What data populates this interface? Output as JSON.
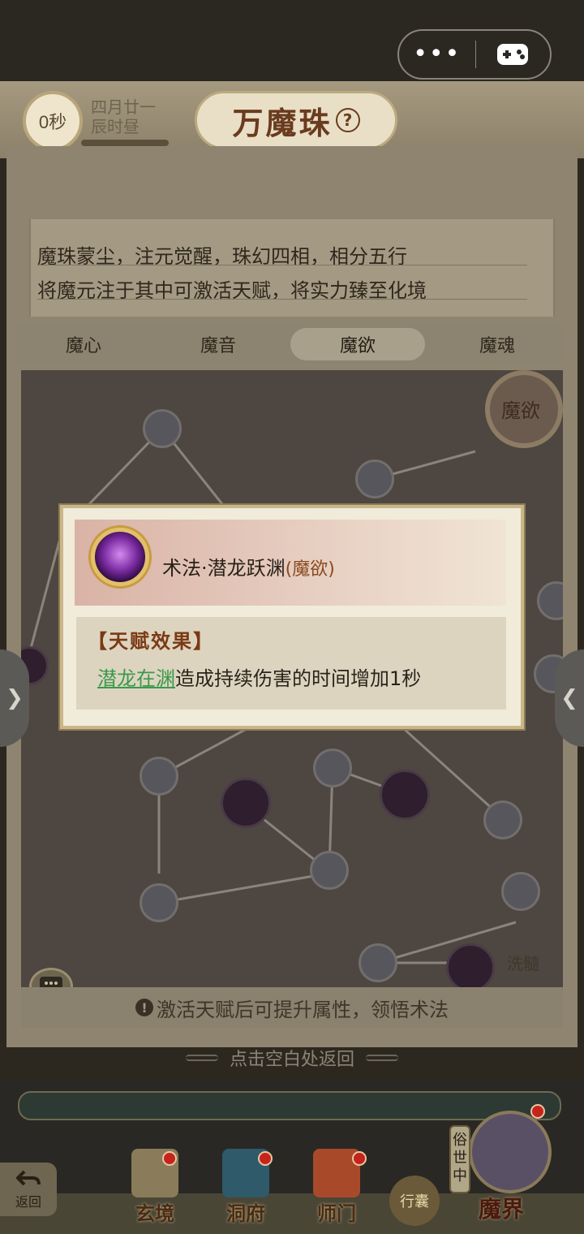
{
  "header": {
    "timer": "0秒",
    "date_line1": "四月廿一",
    "date_line2": "辰时昼",
    "title": "万魔珠",
    "help_label": "?"
  },
  "description": {
    "line1": "魔珠蒙尘，注元觉醒，珠幻四相，相分五行",
    "line2": "将魔元注于其中可激活天赋，将实力臻至化境"
  },
  "tabs": [
    {
      "label": "魔心",
      "active": false
    },
    {
      "label": "魔音",
      "active": false
    },
    {
      "label": "魔欲",
      "active": true
    },
    {
      "label": "魔魂",
      "active": false
    }
  ],
  "board": {
    "badge_label": "魔欲",
    "xisui_label": "洗髓"
  },
  "hint": "激活天赋后可提升属性，领悟术法",
  "return_hint": "点击空白处返回",
  "popup": {
    "skill_name": "术法·潜龙跃渊",
    "skill_tag": "(魔欲)",
    "effect_title": "【天赋效果】",
    "effect_link": "潜龙在渊",
    "effect_rest": "造成持续伤害的时间增加1秒"
  },
  "nav": {
    "back": "返回",
    "items": [
      "玄境",
      "洞府",
      "师门",
      "行囊"
    ],
    "mojie_label": "魔界",
    "mojie_vertical": "俗世中"
  },
  "colors": {
    "accent": "#6a3b1e",
    "link_green": "#3a9a4a",
    "badge_red": "#c4241c"
  }
}
